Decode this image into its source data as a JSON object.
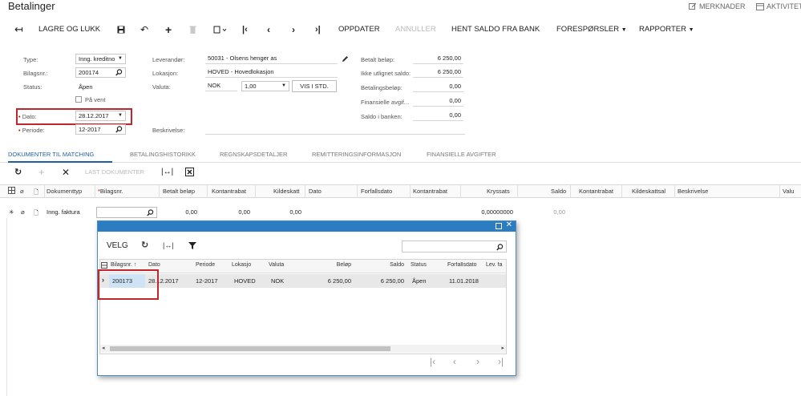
{
  "header": {
    "title": "Betalinger",
    "notes_label": "MERKNADER",
    "activities_label": "AKTIVITETER"
  },
  "toolbar": {
    "save_close": "LAGRE OG LUKK",
    "update": "OPPDATER",
    "cancel": "ANNULLER",
    "bank_balance": "HENT SALDO FRA BANK",
    "inquiries": "FORESPØRSLER",
    "reports": "RAPPORTER"
  },
  "summary": {
    "type_label": "Type:",
    "type_value": "Inng. kreditno",
    "ref_label": "Bilagsnr.:",
    "ref_value": "200174",
    "status_label": "Status:",
    "status_value": "Åpen",
    "hold_label": "På vent",
    "date_label": "Dato:",
    "date_value": "28.12.2017",
    "period_label": "Periode:",
    "period_value": "12-2017",
    "vendor_label": "Leverandør:",
    "vendor_value": "50031 - Olsens henger as",
    "location_label": "Lokasjon:",
    "location_value": "HOVED - Hovedlokasjon",
    "currency_label": "Valuta:",
    "currency_value": "NOK",
    "rate_value": "1,00",
    "view_base": "VIS I STD.",
    "description_label": "Beskrivelse:",
    "paid_label": "Betalt beløp:",
    "paid_value": "6 250,00",
    "unapplied_label": "Ikke utlignet saldo:",
    "unapplied_value": "6 250,00",
    "payment_label": "Betalingsbeløp:",
    "payment_value": "0,00",
    "finance_label": "Finansielle avgif...",
    "finance_value": "0,00",
    "bank_label": "Saldo i banken:",
    "bank_value": "0,00"
  },
  "tabs": [
    "DOKUMENTER TIL MATCHING",
    "BETALINGSHISTORIKK",
    "REGNSKAPSDETALJER",
    "REMITTERINGSINFORMASJON",
    "FINANSIELLE AVGIFTER"
  ],
  "grid": {
    "load_docs": "LAST DOKUMENTER",
    "columns": [
      "Dokumenttyp",
      "Bilagsnr.",
      "Betalt beløp",
      "Kontantrabat",
      "Kildeskatt",
      "Dato",
      "Forfallsdato",
      "Kontantrabat",
      "Kryssats",
      "Saldo",
      "Kontantrabat",
      "Kildeskattsal",
      "Beskrivelse",
      "Valu"
    ],
    "row": {
      "doctype": "Inng. faktura",
      "amount": "0,00",
      "discount": "0,00",
      "tax": "0,00",
      "crossrate": "0,00000000",
      "balance": "0,00"
    }
  },
  "dialog": {
    "select": "VELG",
    "columns": [
      "Bilagsnr.",
      "Dato",
      "Periode",
      "Lokasjo",
      "Valuta",
      "Beløp",
      "Saldo",
      "Status",
      "Forfallsdato",
      "Lev. fa"
    ],
    "row": {
      "ref": "200173",
      "date": "28.12.2017",
      "period": "12-2017",
      "location": "HOVED",
      "currency": "NOK",
      "amount": "6 250,00",
      "balance": "6 250,00",
      "status": "Åpen",
      "due": "11.01.2018"
    }
  },
  "colors": {
    "accent": "#1e5fa0",
    "dialog_header": "#2b7cc0",
    "highlight": "#c0262c",
    "selected_cell": "#cfe3f7"
  }
}
